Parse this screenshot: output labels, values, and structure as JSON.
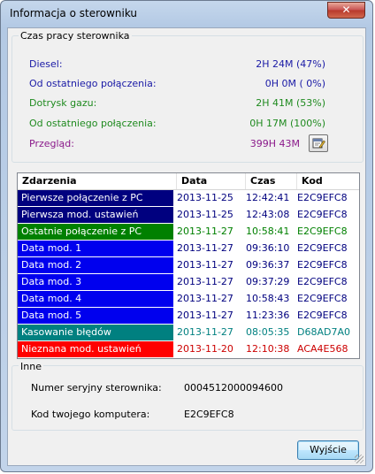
{
  "window": {
    "title": "Informacja o sterowniku",
    "close_label": "✕"
  },
  "runtime": {
    "legend": "Czas pracy sterownika",
    "rows": [
      {
        "label": "Diesel:",
        "value": "2H 24M (47%)",
        "color": "#1a1aa6"
      },
      {
        "label": "Od ostatniego połączenia:",
        "value": "0H  0M ( 0%)",
        "color": "#1a1aa6"
      },
      {
        "label": "Dotrysk gazu:",
        "value": "2H 41M (53%)",
        "color": "#1f8a1f"
      },
      {
        "label": "Od ostatniego połączenia:",
        "value": "0H 17M (100%)",
        "color": "#1f8a1f"
      },
      {
        "label": "Przegląd:",
        "value": "399H 43M",
        "color": "#8b1a8b"
      }
    ],
    "review_icon": "calendar-edit-icon"
  },
  "events": {
    "headers": [
      "Zdarzenia",
      "Data",
      "Czas",
      "Kod"
    ],
    "rows": [
      {
        "event": "Pierwsze połączenie z PC",
        "date": "2013-11-25",
        "time": "12:42:41",
        "code": "E2C9EFC8",
        "bg": "#00007f",
        "fg": "#00007f"
      },
      {
        "event": "Pierwsza mod. ustawień",
        "date": "2013-11-25",
        "time": "12:43:08",
        "code": "E2C9EFC8",
        "bg": "#00007f",
        "fg": "#00007f"
      },
      {
        "event": "Ostatnie połączenie z PC",
        "date": "2013-11-27",
        "time": "10:58:41",
        "code": "E2C9EFC8",
        "bg": "#008000",
        "fg": "#008000"
      },
      {
        "event": "Data mod. 1",
        "date": "2013-11-27",
        "time": "09:36:10",
        "code": "E2C9EFC8",
        "bg": "#0000ee",
        "fg": "#00007f"
      },
      {
        "event": "Data mod. 2",
        "date": "2013-11-27",
        "time": "09:36:37",
        "code": "E2C9EFC8",
        "bg": "#0000ee",
        "fg": "#00007f"
      },
      {
        "event": "Data mod. 3",
        "date": "2013-11-27",
        "time": "09:37:29",
        "code": "E2C9EFC8",
        "bg": "#0000ee",
        "fg": "#00007f"
      },
      {
        "event": "Data mod. 4",
        "date": "2013-11-27",
        "time": "10:58:43",
        "code": "E2C9EFC8",
        "bg": "#0000ee",
        "fg": "#00007f"
      },
      {
        "event": "Data mod. 5",
        "date": "2013-11-27",
        "time": "11:23:36",
        "code": "E2C9EFC8",
        "bg": "#0000ee",
        "fg": "#00007f"
      },
      {
        "event": "Kasowanie błędów",
        "date": "2013-11-27",
        "time": "08:05:35",
        "code": "D68AD7A0",
        "bg": "#008080",
        "fg": "#008080"
      },
      {
        "event": "Nieznana mod. ustawień",
        "date": "2013-11-20",
        "time": "12:10:38",
        "code": "ACA4E568",
        "bg": "#ff0000",
        "fg": "#cc0000"
      }
    ]
  },
  "other": {
    "legend": "Inne",
    "serial_label": "Numer seryjny sterownika:",
    "serial_value": "0004512000094600",
    "computer_label": "Kod twojego komputera:",
    "computer_value": "E2C9EFC8"
  },
  "actions": {
    "exit_label": "Wyjście"
  }
}
